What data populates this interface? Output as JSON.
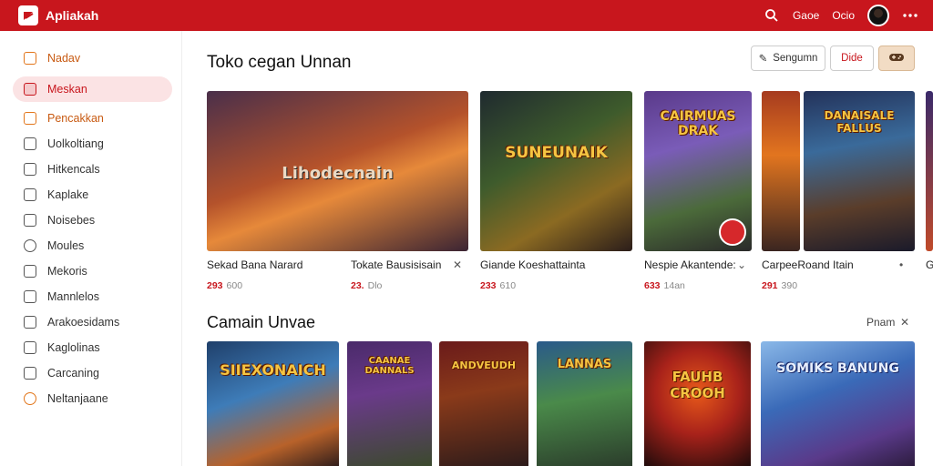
{
  "app": {
    "title": "Apliakah"
  },
  "topbar": {
    "search_icon": "search-icon",
    "link1": "Gaoe",
    "link2": "Ocio",
    "more_icon": "more-horizontal-icon",
    "brand_color": "#c8161d"
  },
  "sidebar": {
    "items": [
      {
        "label": "Nadav",
        "icon": "home-icon"
      },
      {
        "label": "Meskan",
        "icon": "store-icon"
      },
      {
        "label": "Pencakkan",
        "icon": "calendar-icon"
      },
      {
        "label": "Uolkoltiang",
        "icon": "library-icon"
      },
      {
        "label": "Hitkencals",
        "icon": "list-icon"
      },
      {
        "label": "Kaplake",
        "icon": "tag-icon"
      },
      {
        "label": "Noisebes",
        "icon": "grid-icon"
      },
      {
        "label": "Moules",
        "icon": "gear-icon"
      },
      {
        "label": "Mekoris",
        "icon": "document-icon"
      },
      {
        "label": "Mannlelos",
        "icon": "folder-icon"
      },
      {
        "label": "Arakoesidams",
        "icon": "chart-icon"
      },
      {
        "label": "Kaglolinas",
        "icon": "cart-icon"
      },
      {
        "label": "Carcaning",
        "icon": "play-icon"
      },
      {
        "label": "Neltanjaane",
        "icon": "circle-icon"
      }
    ]
  },
  "section1": {
    "title": "Toko cegan Unnan",
    "btn_primary": "Sengumn",
    "btn_secondary": "Dide",
    "cards": [
      {
        "name": "Sekad Bana Narard",
        "price": "293",
        "sub": "600",
        "art_text": "Lihodecnain"
      },
      {
        "name": "Tokate Bausisisain",
        "price": "23.",
        "sub": "Dlo",
        "art_text": "SUNEUNAIK"
      },
      {
        "name": "Giande Koeshattainta",
        "price": "233",
        "sub": "610",
        "art_text": "CAIRMUAS DRAK"
      },
      {
        "name": "Nespie Akantende:",
        "price": "633",
        "sub": "14an",
        "art_text": ""
      },
      {
        "name": "CarpeeRoand Itain",
        "price": "291",
        "sub": "390",
        "art_text": "DANAISALE FALLUS"
      },
      {
        "name": "G",
        "price": "",
        "sub": "",
        "art_text": ""
      }
    ]
  },
  "section2": {
    "title": "Camain Unvae",
    "see_all": "Pnam",
    "cards": [
      {
        "art_text": "SIIEXONAICH"
      },
      {
        "art_text": "CAANAE DANNALS"
      },
      {
        "art_text": "ANDVEUDH"
      },
      {
        "art_text": "LANNAS"
      },
      {
        "art_text": "FAUHB CROOH"
      },
      {
        "art_text": "SOMIKS BANUNG"
      }
    ]
  }
}
